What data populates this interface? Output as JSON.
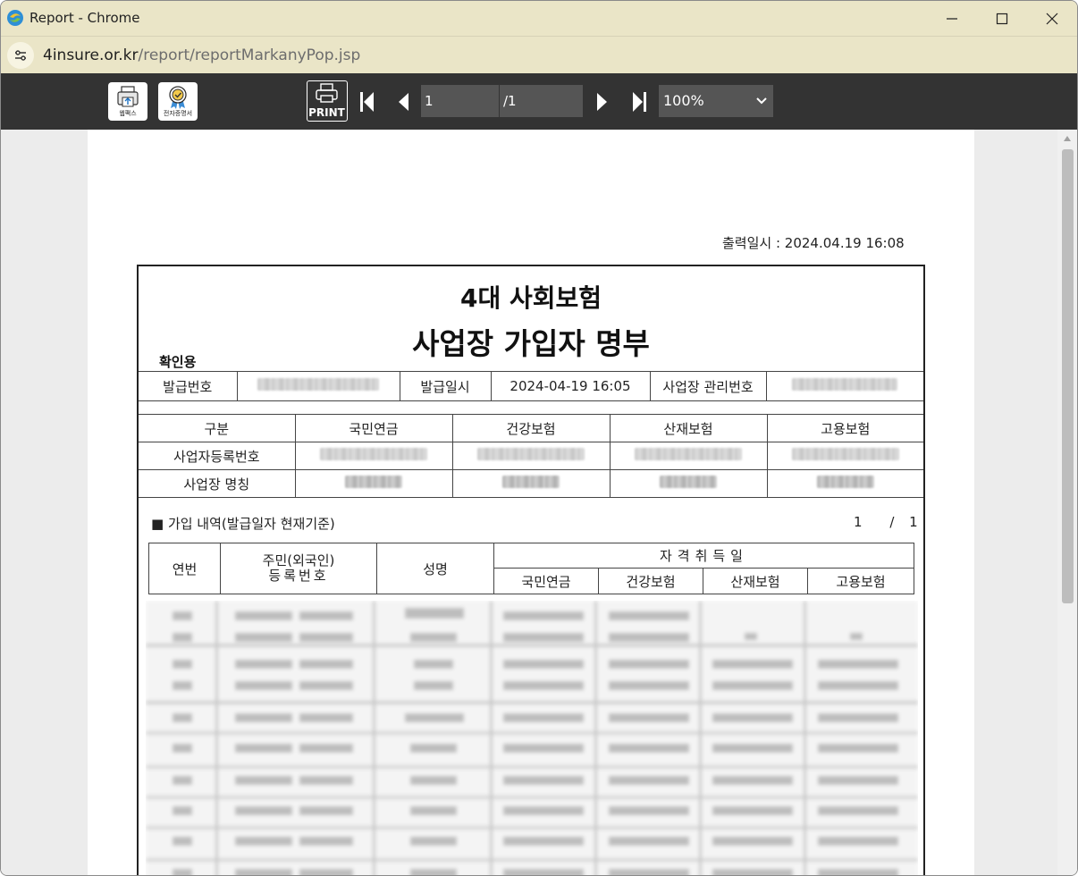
{
  "window": {
    "title": "Report - Chrome",
    "icon": "app-swirl-icon"
  },
  "address": {
    "host": "4insure.or.kr",
    "path": "/report/reportMarkanyPop.jsp"
  },
  "toolbar": {
    "fax_label": "웹팩스",
    "cert_label": "전자증명서",
    "print_label": "PRINT",
    "page_current": "1",
    "page_total": "/1",
    "zoom": "100%"
  },
  "report": {
    "print_datetime": "출력일시 : 2024.04.19 16:08",
    "title_line1": "4대 사회보험",
    "title_line2": "사업장 가입자 명부",
    "confirm_label": "확인용",
    "issue": {
      "issue_no_label": "발급번호",
      "issue_date_label": "발급일시",
      "issue_date": "2024-04-19 16:05",
      "site_no_label": "사업장 관리번호"
    },
    "info": {
      "headers": [
        "구분",
        "국민연금",
        "건강보험",
        "산재보험",
        "고용보험"
      ],
      "row1_label": "사업자등록번호",
      "row2_label": "사업장 명칭"
    },
    "section": {
      "title": "■ 가입 내역(발급일자 현재기준)",
      "page_current": "1",
      "page_sep": "/",
      "page_total": "1"
    },
    "members": {
      "col_no": "연번",
      "col_id_line1": "주민(외국인)",
      "col_id_line2": "등록번호",
      "col_name": "성명",
      "col_group": "자격취득일",
      "sub_headers": [
        "국민연금",
        "건강보험",
        "산재보험",
        "고용보험"
      ]
    }
  }
}
